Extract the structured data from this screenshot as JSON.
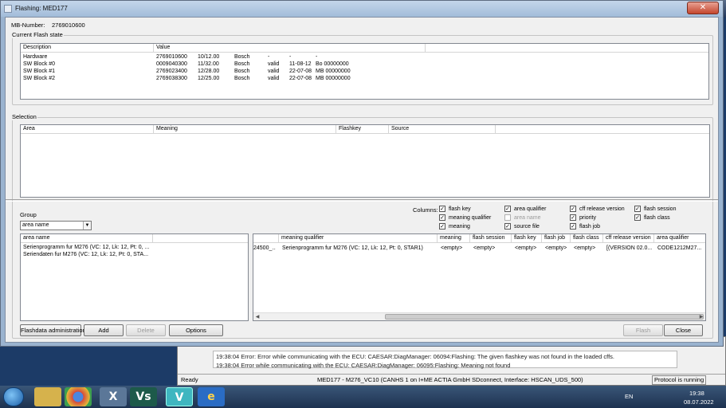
{
  "window": {
    "title": "Flashing: MED177",
    "close_glyph": "✕"
  },
  "mb_number": {
    "label": "MB-Number:",
    "value": "2769010600"
  },
  "current_flash": {
    "group_title": "Current Flash state",
    "columns": [
      "Description",
      "Value"
    ],
    "rows": [
      [
        "Hardware",
        "2769010600",
        "10/12.00",
        "Bosch",
        "-",
        "-",
        "-"
      ],
      [
        "SW Block #0",
        "0009040300",
        "11/32.00",
        "Bosch",
        "valid",
        "11-08-12",
        "Bo 00000000"
      ],
      [
        "SW Block #1",
        "2769023400",
        "12/28.00",
        "Bosch",
        "valid",
        "22-07-08",
        "MB 00000000"
      ],
      [
        "SW Block #2",
        "2769038300",
        "12/25.00",
        "Bosch",
        "valid",
        "22-07-08",
        "MB 00000000"
      ]
    ]
  },
  "selection": {
    "group_title": "Selection",
    "columns": [
      "Area",
      "Meaning",
      "Flashkey",
      "Source"
    ]
  },
  "group": {
    "label": "Group",
    "selected": "area name"
  },
  "columns_label": "Columns:",
  "column_checks": [
    {
      "label": "flash key",
      "checked": true,
      "enabled": true
    },
    {
      "label": "meaning qualifier",
      "checked": true,
      "enabled": true
    },
    {
      "label": "meaning",
      "checked": true,
      "enabled": true
    },
    {
      "label": "area qualifier",
      "checked": true,
      "enabled": true
    },
    {
      "label": "area name",
      "checked": false,
      "enabled": false
    },
    {
      "label": "source file",
      "checked": true,
      "enabled": true
    },
    {
      "label": "cff release version",
      "checked": true,
      "enabled": true
    },
    {
      "label": "priority",
      "checked": true,
      "enabled": true
    },
    {
      "label": "flash job",
      "checked": true,
      "enabled": true
    },
    {
      "label": "flash session",
      "checked": true,
      "enabled": true
    },
    {
      "label": "flash class",
      "checked": true,
      "enabled": true
    }
  ],
  "area_list": {
    "header": "area name",
    "items": [
      "Serienprogramm fur M276 (VC: 12, Lk: 12, Pt: 0, ...",
      "Seriendaten fur M276 (VC: 12, Lk: 12, Pt: 0, STA..."
    ]
  },
  "detail_list": {
    "headers": [
      "",
      "meaning qualifier",
      "meaning",
      "flash session",
      "flash key",
      "flash job",
      "flash class",
      "cff release version",
      "area qualifier"
    ],
    "rows": [
      [
        "24500_...",
        "Serienprogramm fur M276 (VC: 12, Lk: 12, Pt: 0, STAR1)",
        "<empty>",
        "<empty>",
        "<empty>",
        "<empty>",
        "<empty>",
        "[(VERSION 02.0...",
        "CODE1212M27..."
      ]
    ]
  },
  "buttons": {
    "flashdata_admin": "Flashdata administration",
    "add": "Add",
    "delete": "Delete",
    "options": "Options",
    "flash": "Flash",
    "close": "Close"
  },
  "background_window": {
    "log": [
      "19:38:04 Error: Error while communicating with the ECU:  CAESAR:DiagManager: 06094:Flashing: The given flashkey was not found in the loaded cffs.",
      "19:38:04 Error while communicating with the ECU:  CAESAR:DiagManager: 06095:Flashing: Meaning not found"
    ],
    "status_ready": "Ready",
    "status_connection": "MED177 - M276_VC10 (CANHS 1 on I+ME ACTIA GmbH SDconnect, Interface: HSCAN_UDS_500)",
    "status_protocol": "Protocol is running"
  },
  "taskbar": {
    "apps": [
      "explorer-icon",
      "chrome-icon",
      "xentry-icon",
      "vediamo-vs-icon",
      "vediamo-v-icon",
      "ie-icon"
    ],
    "lang": "EN",
    "time": "19:38",
    "date": "08.07.2022"
  }
}
